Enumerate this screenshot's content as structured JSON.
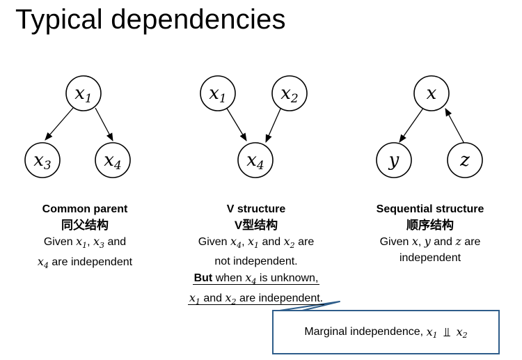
{
  "title": "Typical dependencies",
  "panels": [
    {
      "heading": "Common parent",
      "heading_cn": "同父结构",
      "nodes": [
        {
          "var": "x",
          "sub": "1"
        },
        {
          "var": "x",
          "sub": "3"
        },
        {
          "var": "x",
          "sub": "4"
        }
      ],
      "line1_pre": "Given",
      "line1_v1": "x",
      "line1_v1_sub": "1",
      "line1_sep": ",",
      "line1_v2": "x",
      "line1_v2_sub": "3",
      "line1_post": "and",
      "line2_v": "x",
      "line2_v_sub": "4",
      "line2_post": "are independent"
    },
    {
      "heading": "V structure",
      "heading_cn": "V型结构",
      "nodes": [
        {
          "var": "x",
          "sub": "1"
        },
        {
          "var": "x",
          "sub": "2"
        },
        {
          "var": "x",
          "sub": "4"
        }
      ],
      "line1_pre": "Given",
      "line1_v1": "x",
      "line1_v1_sub": "4",
      "line1_sep": ",",
      "line1_v2": "x",
      "line1_v2_sub": "1",
      "line1_mid": "and",
      "line1_v3": "x",
      "line1_v3_sub": "2",
      "line1_post": "are",
      "line2": "not independent.",
      "line3_bold": "But",
      "line3_pre": "when",
      "line3_v": "x",
      "line3_v_sub": "4",
      "line3_post": "is unknown,",
      "line4_v1": "x",
      "line4_v1_sub": "1",
      "line4_mid": "and",
      "line4_v2": "x",
      "line4_v2_sub": "2",
      "line4_post": "are independent."
    },
    {
      "heading": "Sequential structure",
      "heading_cn": "顺序结构",
      "nodes": [
        {
          "var": "x",
          "sub": ""
        },
        {
          "var": "y",
          "sub": ""
        },
        {
          "var": "z",
          "sub": ""
        }
      ],
      "line1_pre": "Given",
      "line1_v1": "x",
      "line1_sep1": ",",
      "line1_v2": "y",
      "line1_mid": "and",
      "line1_v3": "z",
      "line1_post": "are",
      "line2": "independent"
    }
  ],
  "callout": {
    "text": "Marginal independence,",
    "v1": "x",
    "v1_sub": "1",
    "symbol": "⫫",
    "v2": "x",
    "v2_sub": "2",
    "border_color": "#2e5d8a"
  }
}
